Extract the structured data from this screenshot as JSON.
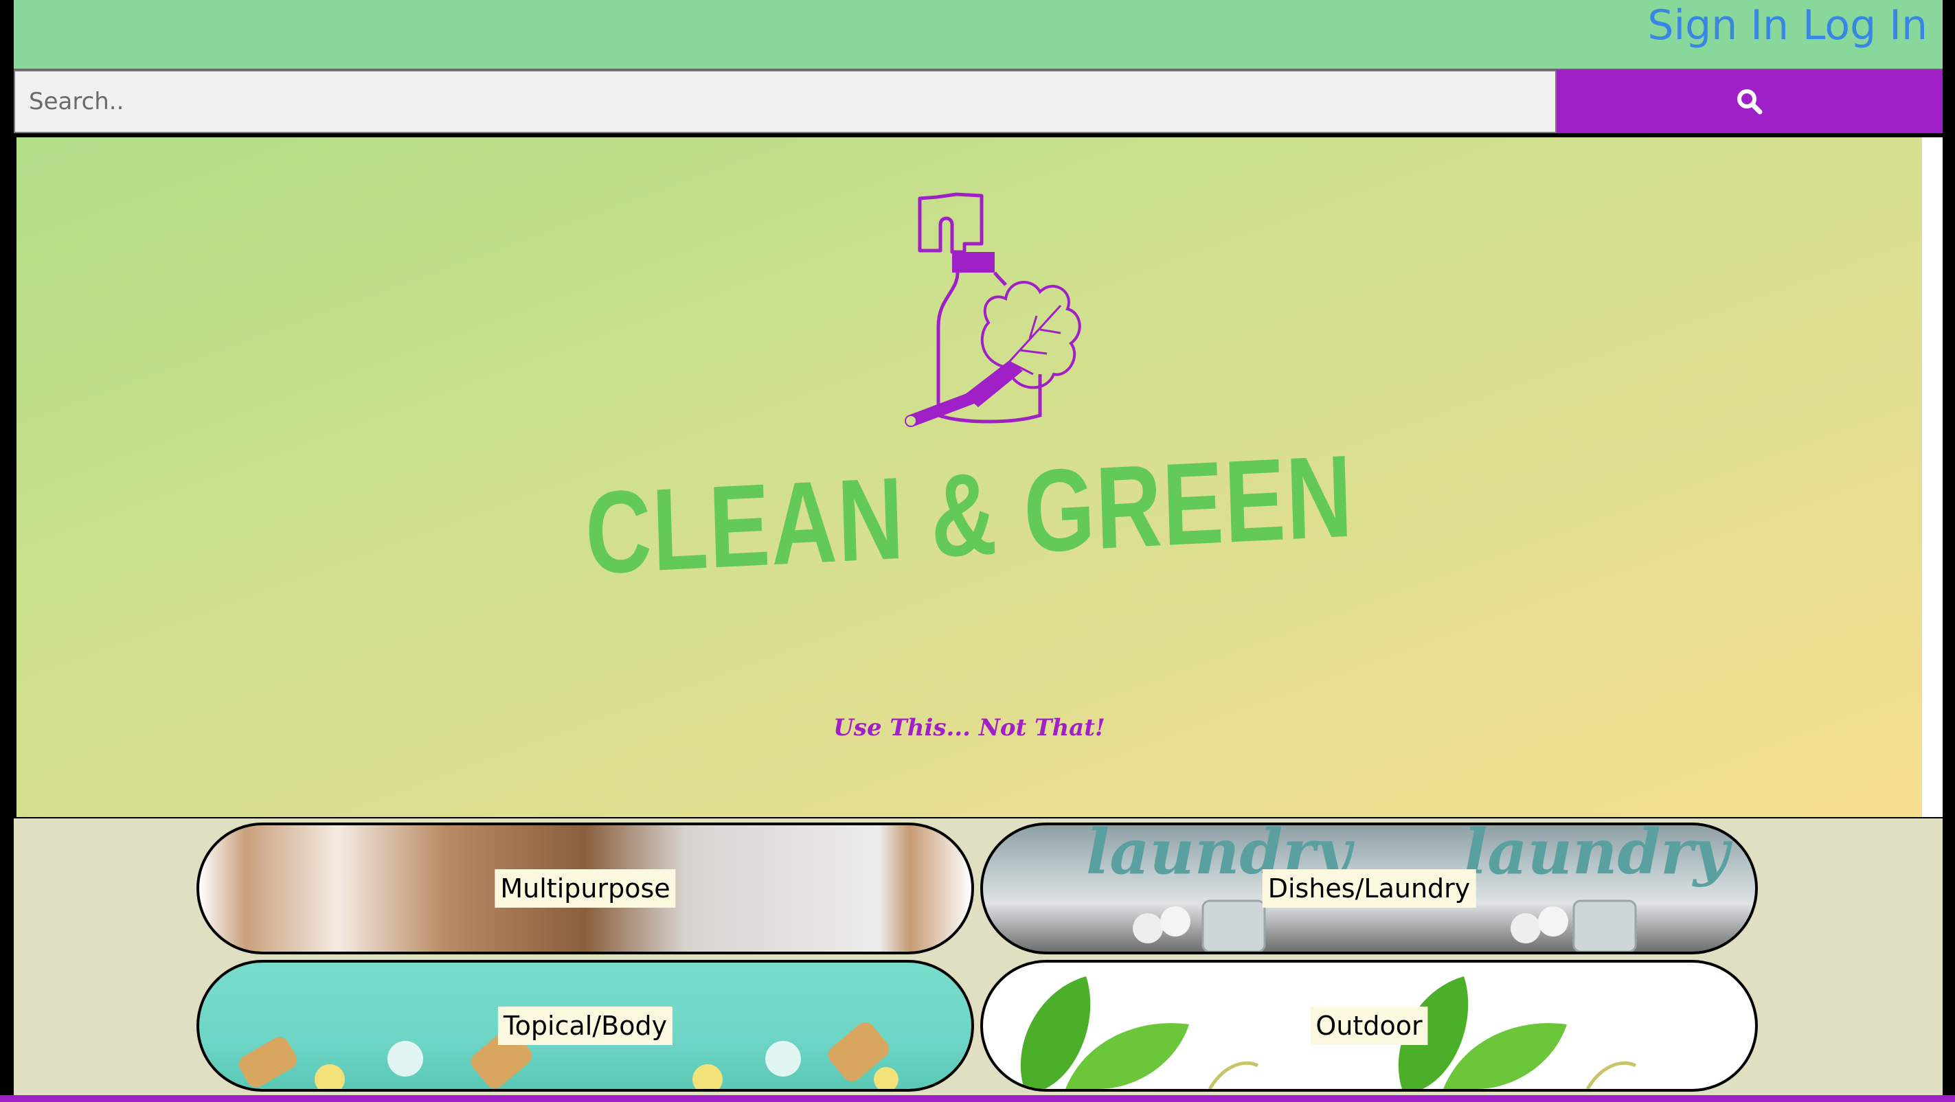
{
  "header": {
    "sign_in": "Sign In",
    "log_in": "Log In"
  },
  "search": {
    "placeholder": "Search..",
    "button_icon": "search-icon"
  },
  "hero": {
    "brand": "CLEAN & GREEN",
    "tagline": "Use This... Not That!",
    "logo_icon": "spray-bottle-duster-icon"
  },
  "categories": [
    {
      "label": "Multipurpose"
    },
    {
      "label": "Dishes/Laundry"
    },
    {
      "label": "Topical/Body"
    },
    {
      "label": "Outdoor"
    }
  ],
  "colors": {
    "accent_purple": "#a020c8",
    "brand_green": "#63c957",
    "link_blue": "#3a86e3",
    "topbar_green": "#89d89b"
  }
}
